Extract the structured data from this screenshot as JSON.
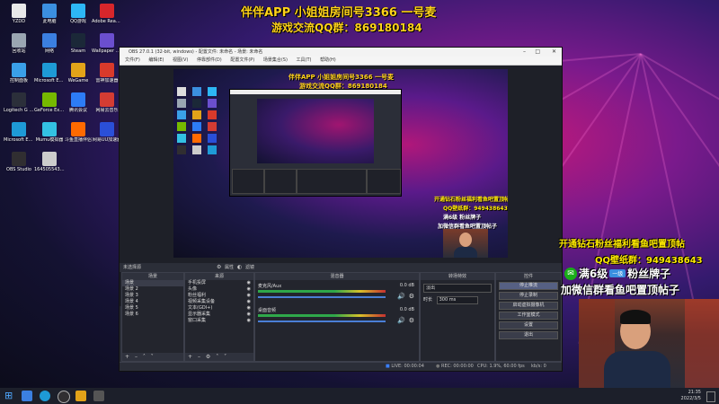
{
  "overlay": {
    "title": "伴伴APP 小姐姐房间号3366 一号麦",
    "qq_group": "游戏交流QQ群：869180184",
    "promo_line1": "开通钻石粉丝福利看鱼吧置顶帖",
    "promo_line2": "QQ壁纸群：949438643",
    "promo_line3": "满6级",
    "promo_badge": "粉丝牌子",
    "promo_line4": "加微信群看鱼吧置顶帖子"
  },
  "desktop_icons": [
    {
      "label": "YZDD",
      "color": "#e9e9e9"
    },
    {
      "label": "此电脑",
      "color": "#3b8fe0"
    },
    {
      "label": "QQ游戏",
      "color": "#2db7f5"
    },
    {
      "label": "Adobe Reader",
      "color": "#d8262b"
    },
    {
      "label": "回收站",
      "color": "#9aa6b2"
    },
    {
      "label": "网络",
      "color": "#3b7fe0"
    },
    {
      "label": "Steam",
      "color": "#1b2838"
    },
    {
      "label": "Wallpaper Engine",
      "color": "#6b4fcf"
    },
    {
      "label": "控制面板",
      "color": "#3aa0e8"
    },
    {
      "label": "Microsoft Edge",
      "color": "#1e9ad6"
    },
    {
      "label": "WeGame",
      "color": "#e2a319"
    },
    {
      "label": "雷神加速器",
      "color": "#d83a2b"
    },
    {
      "label": "Logitech G HUB",
      "color": "#2b2f3a"
    },
    {
      "label": "GeForce Experience",
      "color": "#76b900"
    },
    {
      "label": "腾讯会议",
      "color": "#2d7cf6"
    },
    {
      "label": "网易云音乐",
      "color": "#d43c33"
    },
    {
      "label": "Microsoft Edge",
      "color": "#1e9ad6"
    },
    {
      "label": "Mumu模拟器",
      "color": "#33c1e3"
    },
    {
      "label": "斗鱼直播伴侣",
      "color": "#ff6a00"
    },
    {
      "label": "网易UU加速器",
      "color": "#2a4fd8"
    },
    {
      "label": "OBS Studio",
      "color": "#302e31"
    },
    {
      "label": "1645055432 1965917...",
      "color": "#cccccc"
    }
  ],
  "obs": {
    "window_title": "OBS 27.0.1 (32-bit, windows) - 配置文件: 未命名 - 场景: 未命名",
    "menu": [
      "文件(F)",
      "编辑(E)",
      "视图(V)",
      "停靠部件(D)",
      "配置文件(P)",
      "场景集合(S)",
      "工具(T)",
      "帮助(H)"
    ],
    "no_source_selected": "未选择源",
    "properties_label": "属性",
    "filters_label": "滤镜",
    "scenes_header": "场景",
    "scenes": [
      "场景",
      "场景 2",
      "场景 3",
      "场景 4",
      "场景 5",
      "场景 6"
    ],
    "sources_header": "来源",
    "sources": [
      "手机投屏",
      "头像",
      "粉丝福利",
      "视频采集设备",
      "文本(GDI+)",
      "显示器采集",
      "窗口采集"
    ],
    "mixer_header": "混音器",
    "mixer": [
      {
        "name": "麦克风/Aux",
        "db": "0.0 dB"
      },
      {
        "name": "桌面音频",
        "db": "0.0 dB"
      }
    ],
    "transition_header": "转场特效",
    "transition_type": "淡出",
    "duration_label": "时长",
    "duration_value": "300 ms",
    "controls_header": "控件",
    "controls": [
      "停止推流",
      "停止录制",
      "启动虚拟摄像机",
      "工作室模式",
      "设置",
      "退出"
    ],
    "status": {
      "live": "LIVE: 00:00:04",
      "rec": "REC: 00:00:00",
      "cpu": "CPU: 1.9%, 60.00 fps",
      "kbps": "kb/s: 0"
    }
  },
  "nested": {
    "overlay_title": "伴伴APP 小姐姐房间号3366 一号麦",
    "overlay_qq": "游戏交流QQ群：869180184",
    "promo1": "开通钻石粉丝福利看鱼吧置顶帖",
    "promo2": "QQ壁纸群：949438643",
    "promo3": "满6级 粉丝牌子",
    "promo4": "加微信群看鱼吧置顶帖子"
  },
  "taskbar": {
    "time": "21:35",
    "date": "2022/3/5"
  }
}
